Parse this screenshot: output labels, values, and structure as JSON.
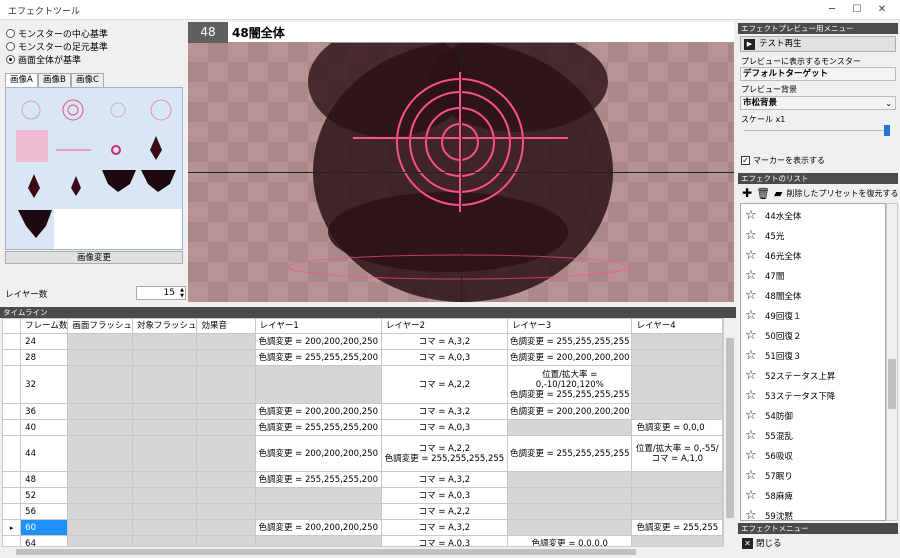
{
  "window": {
    "title": "エフェクトツール",
    "min": "─",
    "max": "☐",
    "close": "✕"
  },
  "anchors": [
    {
      "label": "モンスターの中心基準",
      "selected": false
    },
    {
      "label": "モンスターの足元基準",
      "selected": false
    },
    {
      "label": "画面全体が基準",
      "selected": true
    }
  ],
  "image_tabs": [
    "画像A",
    "画像B",
    "画像C"
  ],
  "change_image": "画像変更",
  "layer_count_label": "レイヤー数",
  "layer_count": "15",
  "preview": {
    "number": "48",
    "name": "48闇全体"
  },
  "right": {
    "menu_header": "エフェクトプレビュー用メニュー",
    "test_play": "テスト再生",
    "monster_label": "プレビューに表示するモンスター",
    "monster_value": "デフォルトターゲット",
    "bg_label": "プレビュー背景",
    "bg_value": "市松背景",
    "scale_label": "スケール x1",
    "show_marker": "マーカーを表示する",
    "list_header": "エフェクトのリスト",
    "restore_preset": "削除したプリセットを復元する",
    "effect_menu_header": "エフェクトメニュー",
    "close": "閉じる",
    "effects": [
      "44水全体",
      "45光",
      "46光全体",
      "47闇",
      "48闇全体",
      "49回復１",
      "50回復２",
      "51回復３",
      "52ステータス上昇",
      "53ステータス下降",
      "54防御",
      "55混乱",
      "56吸収",
      "57眠り",
      "58麻痺",
      "59沈黙"
    ]
  },
  "timeline": {
    "header": "タイムライン",
    "columns": [
      "フレーム数",
      "画面フラッシュ",
      "対象フラッシュ",
      "効果音",
      "レイヤー1",
      "レイヤー2",
      "レイヤー3",
      "レイヤー4"
    ],
    "rows": [
      {
        "frame": "24",
        "l1": "色調変更 = 200,200,200,250",
        "l2": "コマ = A,3,2",
        "l3": "色調変更 = 255,255,255,255",
        "l4": ""
      },
      {
        "frame": "28",
        "l1": "色調変更 = 255,255,255,200",
        "l2": "コマ = A,0,3",
        "l3": "色調変更 = 200,200,200,200",
        "l4": ""
      },
      {
        "frame": "32",
        "l1": "",
        "l2": "コマ = A,2,2",
        "l3a": "位置/拡大率 =",
        "l3b": "0,-10/120,120%",
        "l3c": "色調変更 = 255,255,255,255",
        "l4": ""
      },
      {
        "frame": "36",
        "l1": "色調変更 = 200,200,200,250",
        "l2": "コマ = A,3,2",
        "l3": "色調変更 = 200,200,200,200",
        "l4": ""
      },
      {
        "frame": "40",
        "l1": "色調変更 = 255,255,255,200",
        "l2": "コマ = A,0,3",
        "l3": "",
        "l4": "色調変更 = 0,0,0"
      },
      {
        "frame": "44",
        "l1": "色調変更 = 200,200,200,250",
        "l2a": "コマ = A,2,2",
        "l2b": "色調変更 = 255,255,255,255",
        "l3": "色調変更 = 255,255,255,255",
        "l4a": "位置/拡大率 = 0,-55/",
        "l4b": "コマ = A,1,0"
      },
      {
        "frame": "48",
        "l1": "色調変更 = 255,255,255,200",
        "l2": "コマ = A,3,2",
        "l3": "",
        "l4": ""
      },
      {
        "frame": "52",
        "l1": "",
        "l2": "コマ = A,0,3",
        "l3": "",
        "l4": ""
      },
      {
        "frame": "56",
        "l1": "",
        "l2": "コマ = A,2,2",
        "l3": "",
        "l4": ""
      },
      {
        "frame": "60",
        "l1": "色調変更 = 200,200,200,250",
        "l2": "コマ = A,3,2",
        "l3": "",
        "l4": "色調変更 = 255,255"
      },
      {
        "frame": "64",
        "l1": "",
        "l2": "コマ = A,0,3",
        "l3": "色調変更 = 0,0,0,0",
        "l4": ""
      }
    ]
  },
  "colors": {
    "accent": "#1e90ff",
    "header_bg": "#4b4b4b",
    "magic": "#ff4f8a"
  }
}
